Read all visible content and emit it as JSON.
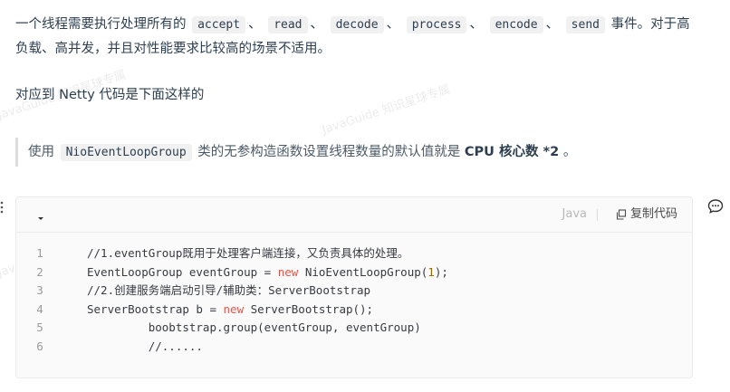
{
  "para1": {
    "prefix": "一个线程需要执行处理所有的",
    "codes": [
      "accept",
      "read",
      "decode",
      "process",
      "encode",
      "send"
    ],
    "separator": "、",
    "suffix_line1": "事件。对于高",
    "line2": "负载、高并发，并且对性能要求比较高的场景不适用。"
  },
  "para2": "对应到 Netty 代码是下面这样的",
  "quote": {
    "prefix": "使用",
    "code": "NioEventLoopGroup",
    "middle": "类的无参构造函数设置线程数量的默认值就是",
    "strong": "CPU 核心数 *2",
    "suffix": "。"
  },
  "watermark": "JavaGuide 知识星球专属",
  "code_block": {
    "language": "Java",
    "copy_label": "复制代码",
    "lines": [
      {
        "n": "1",
        "parts": [
          {
            "t": "//1.eventGroup既用于处理客户端连接，又负责具体的处理。",
            "c": "cmt"
          }
        ]
      },
      {
        "n": "2",
        "parts": [
          {
            "t": "EventLoopGroup eventGroup = ",
            "c": ""
          },
          {
            "t": "new",
            "c": "kw"
          },
          {
            "t": " NioEventLoopGroup(",
            "c": ""
          },
          {
            "t": "1",
            "c": "num"
          },
          {
            "t": ");",
            "c": ""
          }
        ]
      },
      {
        "n": "3",
        "parts": [
          {
            "t": "//2.创建服务端启动引导/辅助类：ServerBootstrap",
            "c": "cmt"
          }
        ]
      },
      {
        "n": "4",
        "parts": [
          {
            "t": "ServerBootstrap b = ",
            "c": ""
          },
          {
            "t": "new",
            "c": "kw"
          },
          {
            "t": " ServerBootstrap();",
            "c": ""
          }
        ]
      },
      {
        "n": "5",
        "parts": [
          {
            "t": "         boobtstrap.group(eventGroup, eventGroup)",
            "c": ""
          }
        ]
      },
      {
        "n": "6",
        "parts": [
          {
            "t": "         //......",
            "c": "cmt"
          }
        ]
      }
    ]
  },
  "icons": {
    "drag": "drag-handle-icon",
    "comment": "comment-icon",
    "collapse": "chevron-down-icon",
    "copy": "copy-icon"
  }
}
